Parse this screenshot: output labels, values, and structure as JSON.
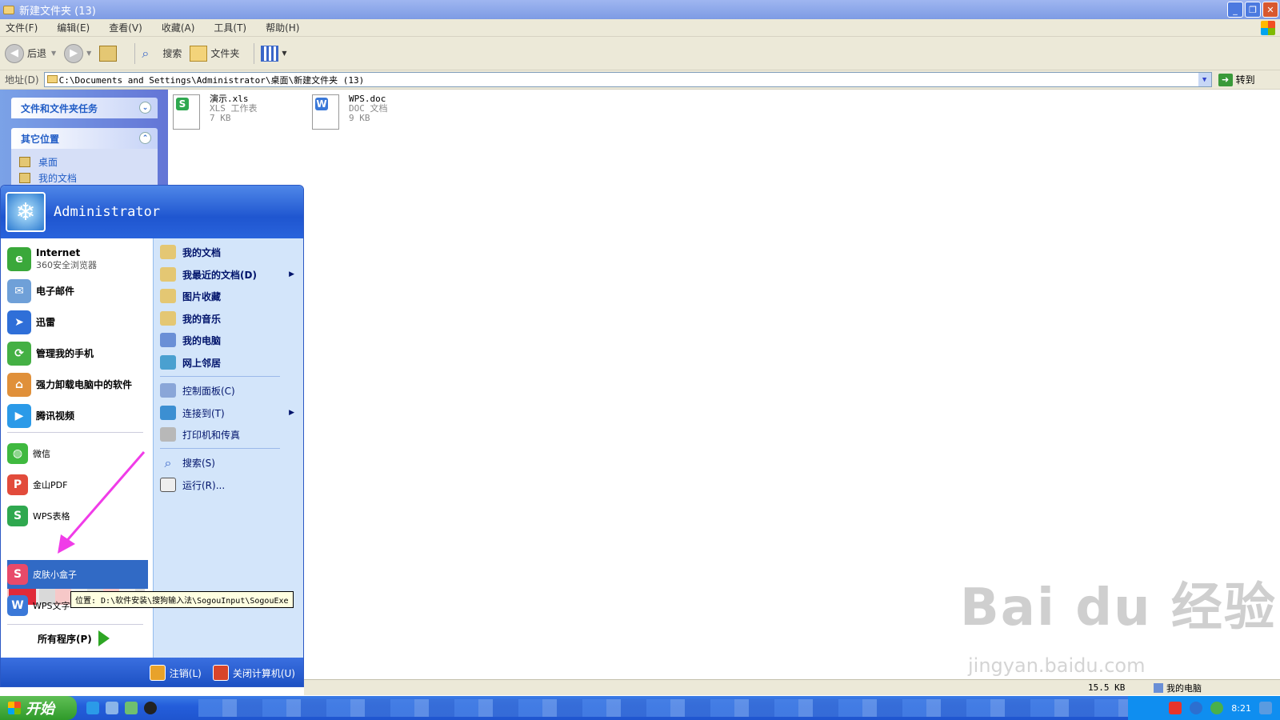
{
  "window": {
    "title": "新建文件夹 (13)"
  },
  "menu": [
    "文件(F)",
    "编辑(E)",
    "查看(V)",
    "收藏(A)",
    "工具(T)",
    "帮助(H)"
  ],
  "toolbar": {
    "back": "后退",
    "search": "搜索",
    "folders": "文件夹"
  },
  "address": {
    "label": "地址(D)",
    "path": "C:\\Documents and Settings\\Administrator\\桌面\\新建文件夹 (13)",
    "go": "转到"
  },
  "taskpane": {
    "tasks_title": "文件和文件夹任务",
    "places_title": "其它位置",
    "places": [
      "桌面",
      "我的文档"
    ]
  },
  "files": [
    {
      "name": "演示.xls",
      "type": "XLS 工作表",
      "size": "7 KB",
      "icon": "S",
      "color": "#2fa84f"
    },
    {
      "name": "WPS.doc",
      "type": "DOC 文档",
      "size": "9 KB",
      "icon": "W",
      "color": "#3a78d8"
    }
  ],
  "start_menu": {
    "user": "Administrator",
    "pinned": [
      {
        "label": "Internet",
        "sub": "360安全浏览器",
        "color": "#3aa83a"
      },
      {
        "label": "电子邮件",
        "color": "#6fa0d8"
      },
      {
        "label": "迅雷",
        "color": "#2f6fd8"
      },
      {
        "label": "管理我的手机",
        "color": "#44b044"
      },
      {
        "label": "强力卸载电脑中的软件",
        "color": "#e0903a"
      },
      {
        "label": "腾讯视频",
        "color": "#2b9ae8"
      }
    ],
    "recent": [
      {
        "label": "微信",
        "color": "#3fb93f"
      },
      {
        "label": "金山PDF",
        "color": "#e24b3b"
      },
      {
        "label": "WPS表格",
        "color": "#2fa84f"
      }
    ],
    "selected": {
      "label": "皮肤小盒子",
      "color": "#e84a6a"
    },
    "after": {
      "label": "WPS文字",
      "color": "#3a78d8"
    },
    "all_programs": "所有程序(P)",
    "right": [
      {
        "label": "我的文档",
        "bold": true,
        "arrow": false
      },
      {
        "label": "我最近的文档(D)",
        "bold": true,
        "arrow": true
      },
      {
        "label": "图片收藏",
        "bold": true,
        "arrow": false
      },
      {
        "label": "我的音乐",
        "bold": true,
        "arrow": false
      },
      {
        "label": "我的电脑",
        "bold": true,
        "arrow": false
      },
      {
        "label": "网上邻居",
        "bold": true,
        "arrow": false
      },
      {
        "label": "控制面板(C)",
        "bold": false,
        "arrow": false
      },
      {
        "label": "连接到(T)",
        "bold": false,
        "arrow": true
      },
      {
        "label": "打印机和传真",
        "bold": false,
        "arrow": false
      },
      {
        "label": "搜索(S)",
        "bold": false,
        "arrow": false
      },
      {
        "label": "运行(R)...",
        "bold": false,
        "arrow": false
      }
    ],
    "logoff": "注销(L)",
    "shutdown": "关闭计算机(U)"
  },
  "tooltip": "位置: D:\\软件安装\\搜狗输入法\\SogouInput\\SogouExe",
  "statusbar": {
    "size": "15.5 KB",
    "location": "我的电脑"
  },
  "taskbar": {
    "start": "开始",
    "time": "8:21"
  },
  "watermark": {
    "brand": "Bai du 经验",
    "url": "jingyan.baidu.com"
  }
}
